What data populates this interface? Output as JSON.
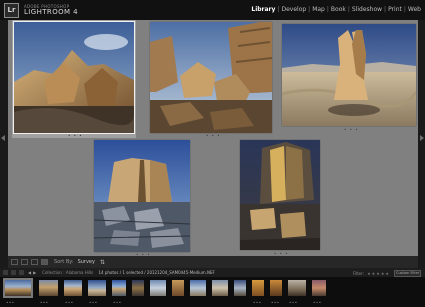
{
  "app": {
    "logo_text": "Lr",
    "subtitle": "ADOBE PHOTOSHOP",
    "title": "LIGHTROOM 4",
    "modules": [
      {
        "label": "Library",
        "active": true
      },
      {
        "label": "Develop",
        "active": false
      },
      {
        "label": "Map",
        "active": false
      },
      {
        "label": "Book",
        "active": false
      },
      {
        "label": "Slideshow",
        "active": false
      },
      {
        "label": "Print",
        "active": false
      },
      {
        "label": "Web",
        "active": false
      }
    ],
    "module_separator": "|"
  },
  "grid": {
    "background": "#808080",
    "photos": [
      {
        "name": "hoodoo-rocks-blue-sky",
        "selected": true,
        "stars": "• • •"
      },
      {
        "name": "cracked-rock-slabs",
        "selected": false,
        "stars": "• • •"
      },
      {
        "name": "sandstone-monolith-dunes",
        "selected": false,
        "stars": "• • •"
      },
      {
        "name": "split-rock-cracked-ground",
        "selected": false,
        "stars": "• • •"
      },
      {
        "name": "lit-sandstone-blocks",
        "selected": false,
        "stars": "• • •"
      }
    ]
  },
  "toolbar": {
    "sort_label": "Sort By:",
    "sort_value": "Survey",
    "sort_icon": "sort-direction-icon"
  },
  "filmbar": {
    "breadcrumb_prefix": "Collection : Alabama Hills",
    "breadcrumb_detail": "14 photos / 1 selected / 20121204_SAM0445-Medium.NEF",
    "filter_label": "Filter:",
    "filter_stars": "★★★★★",
    "filter_value": "Custom Filter"
  },
  "filmstrip": {
    "thumbnails": [
      {
        "selected": true,
        "stars": "•••"
      },
      {
        "selected": false,
        "stars": "•••"
      },
      {
        "selected": false,
        "stars": "•••"
      },
      {
        "selected": false,
        "stars": "•••"
      },
      {
        "selected": false,
        "stars": "•••"
      },
      {
        "selected": false,
        "stars": ""
      },
      {
        "selected": false,
        "stars": ""
      },
      {
        "selected": false,
        "stars": ""
      },
      {
        "selected": false,
        "stars": ""
      },
      {
        "selected": false,
        "stars": ""
      },
      {
        "selected": false,
        "stars": ""
      },
      {
        "selected": false,
        "stars": "•••"
      },
      {
        "selected": false,
        "stars": "•••"
      },
      {
        "selected": false,
        "stars": "•••"
      },
      {
        "selected": false,
        "stars": "•••"
      }
    ]
  },
  "colors": {
    "accent": "#ffffff",
    "grid_bg": "#808080",
    "topbar_bg": "#111111",
    "filmstrip_bg": "#0d0d0d"
  }
}
